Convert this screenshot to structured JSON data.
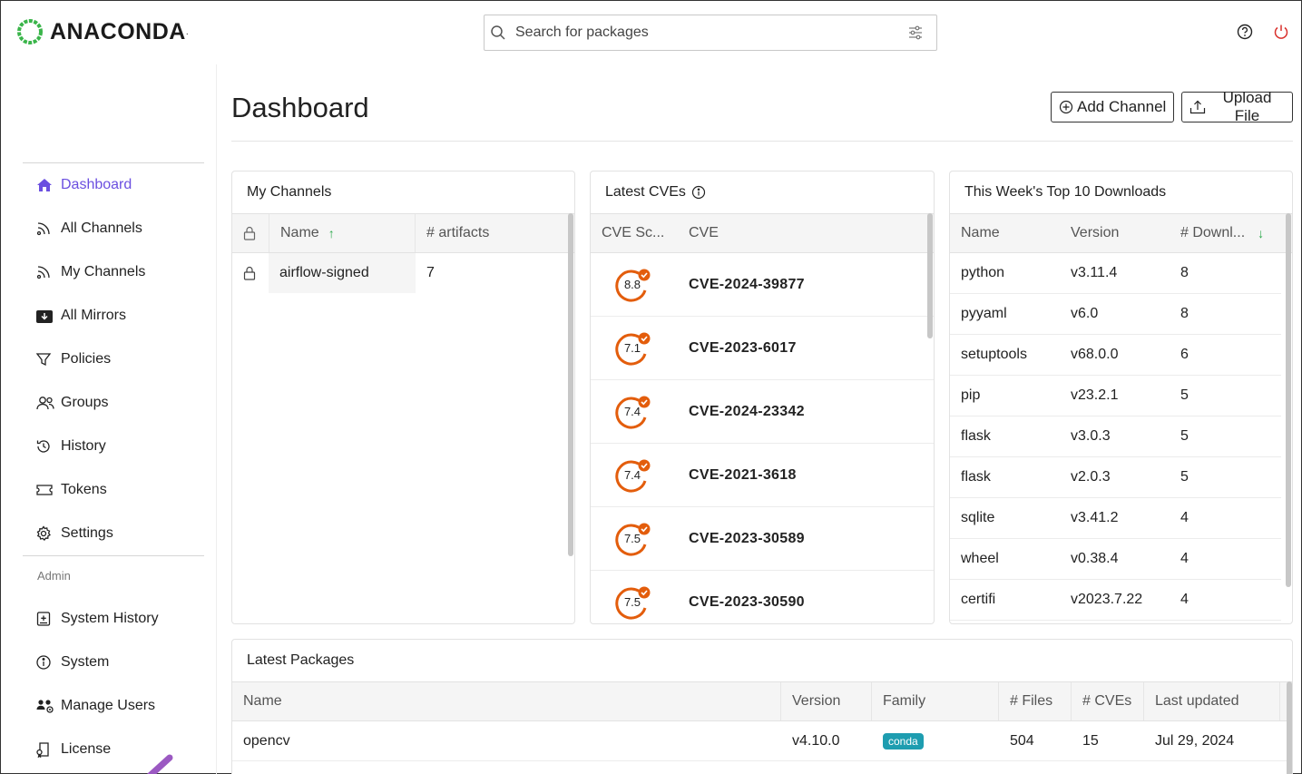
{
  "brand": {
    "name": "ANACONDA",
    "mark": "."
  },
  "search": {
    "placeholder": "Search for packages"
  },
  "sidebar": {
    "items": [
      {
        "label": "Dashboard",
        "icon": "home-icon"
      },
      {
        "label": "All Channels",
        "icon": "channels-icon"
      },
      {
        "label": "My Channels",
        "icon": "channels-icon"
      },
      {
        "label": "All Mirrors",
        "icon": "mirror-icon"
      },
      {
        "label": "Policies",
        "icon": "filter-icon"
      },
      {
        "label": "Groups",
        "icon": "users-icon"
      },
      {
        "label": "History",
        "icon": "history-icon"
      },
      {
        "label": "Tokens",
        "icon": "token-icon"
      },
      {
        "label": "Settings",
        "icon": "gear-icon"
      }
    ],
    "admin_label": "Admin",
    "admin_items": [
      {
        "label": "System History",
        "icon": "system-history-icon"
      },
      {
        "label": "System",
        "icon": "info-icon"
      },
      {
        "label": "Manage Users",
        "icon": "manage-users-icon"
      },
      {
        "label": "License",
        "icon": "license-icon"
      }
    ]
  },
  "header": {
    "title": "Dashboard",
    "add_channel": "Add Channel",
    "upload_file": "Upload File"
  },
  "my_channels": {
    "title": "My Channels",
    "columns": [
      "Name",
      "# artifacts"
    ],
    "rows": [
      {
        "name": "airflow-signed",
        "artifacts": "7"
      }
    ]
  },
  "latest_cves": {
    "title": "Latest CVEs",
    "columns": [
      "CVE Sc...",
      "CVE"
    ],
    "rows": [
      {
        "score": "8.8",
        "id": "CVE-2024-39877"
      },
      {
        "score": "7.1",
        "id": "CVE-2023-6017"
      },
      {
        "score": "7.4",
        "id": "CVE-2024-23342"
      },
      {
        "score": "7.4",
        "id": "CVE-2021-3618"
      },
      {
        "score": "7.5",
        "id": "CVE-2023-30589"
      },
      {
        "score": "7.5",
        "id": "CVE-2023-30590"
      }
    ],
    "badge_color": "#e35d0c"
  },
  "top_downloads": {
    "title": "This Week's Top 10 Downloads",
    "columns": [
      "Name",
      "Version",
      "# Downl..."
    ],
    "rows": [
      {
        "name": "python",
        "version": "v3.11.4",
        "downloads": "8"
      },
      {
        "name": "pyyaml",
        "version": "v6.0",
        "downloads": "8"
      },
      {
        "name": "setuptools",
        "version": "v68.0.0",
        "downloads": "6"
      },
      {
        "name": "pip",
        "version": "v23.2.1",
        "downloads": "5"
      },
      {
        "name": "flask",
        "version": "v3.0.3",
        "downloads": "5"
      },
      {
        "name": "flask",
        "version": "v2.0.3",
        "downloads": "5"
      },
      {
        "name": "sqlite",
        "version": "v3.41.2",
        "downloads": "4"
      },
      {
        "name": "wheel",
        "version": "v0.38.4",
        "downloads": "4"
      },
      {
        "name": "certifi",
        "version": "v2023.7.22",
        "downloads": "4"
      }
    ]
  },
  "latest_packages": {
    "title": "Latest Packages",
    "columns": [
      "Name",
      "Version",
      "Family",
      "# Files",
      "# CVEs",
      "Last updated"
    ],
    "rows": [
      {
        "name": "opencv",
        "version": "v4.10.0",
        "family": "conda",
        "files": "504",
        "cves": "15",
        "updated": "Jul 29, 2024"
      }
    ]
  },
  "colors": {
    "accent": "#6b4fe0",
    "brand_green": "#3ab54a",
    "power": "#d9302c",
    "annotation_arrow": "#9b59c2"
  }
}
